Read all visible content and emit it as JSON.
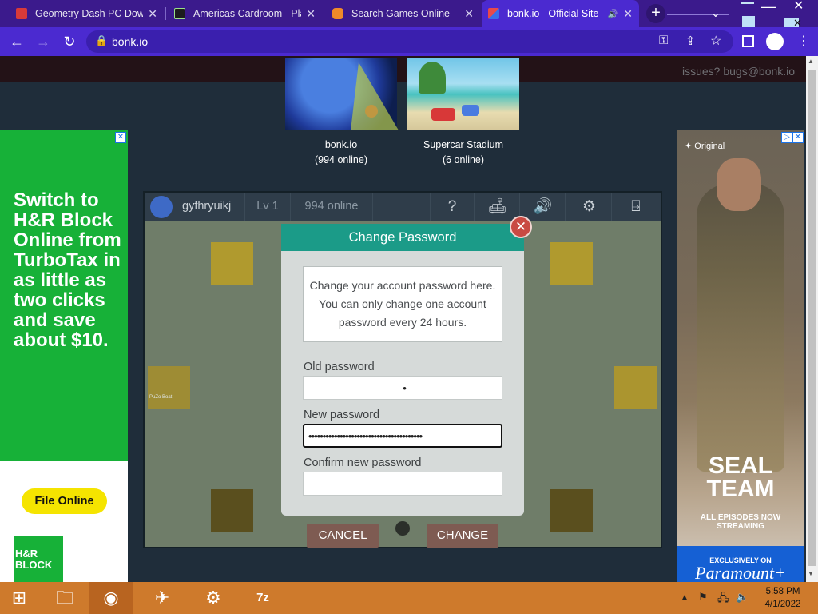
{
  "browser": {
    "tabs": [
      {
        "title": "Geometry Dash PC Down",
        "icon": "game-favicon-red"
      },
      {
        "title": "Americas Cardroom - Pla",
        "icon": "cardroom-favicon"
      },
      {
        "title": "Search Games Online",
        "icon": "gamepad-favicon"
      },
      {
        "title": "bonk.io - Official Site",
        "icon": "bonk-favicon",
        "active": true
      }
    ],
    "url": "bonk.io"
  },
  "page": {
    "issues_text": "issues? bugs@bonk.io",
    "games": [
      {
        "name": "bonk.io",
        "online": "(994 online)"
      },
      {
        "name": "Supercar Stadium",
        "online": "(6 online)"
      }
    ]
  },
  "ads": {
    "left": {
      "headline": "Switch to H&R Block Online from TurboTax in as little as two clicks and save about $10.",
      "button": "File Online",
      "logo": "H&R BLOCK"
    },
    "right": {
      "badge": "Original",
      "title": "SEAL TEAM",
      "subtitle": "ALL EPISODES NOW STREAMING",
      "cta_top": "EXCLUSIVELY ON",
      "cta_brand": "Paramount+"
    }
  },
  "game": {
    "username": "gyfhryuikj",
    "level": "Lv 1",
    "online": "994 online",
    "block_label": "PuZo Boat"
  },
  "dialog": {
    "title": "Change Password",
    "info": "Change your account password here. You can only change one account password every 24 hours.",
    "old_label": "Old password",
    "old_value": "•",
    "new_label": "New password",
    "new_value": "••••••••••••••••••••••••••••••••••••••••",
    "confirm_label": "Confirm new password",
    "confirm_value": "",
    "cancel": "CANCEL",
    "change": "CHANGE"
  },
  "taskbar": {
    "time": "5:58 PM",
    "date": "4/1/2022"
  },
  "colors": {
    "browser_tab": "#3b1a8c",
    "browser_active": "#4b2ad0",
    "dialog_header": "#1b9b88",
    "taskbar": "#ce7a2c"
  }
}
